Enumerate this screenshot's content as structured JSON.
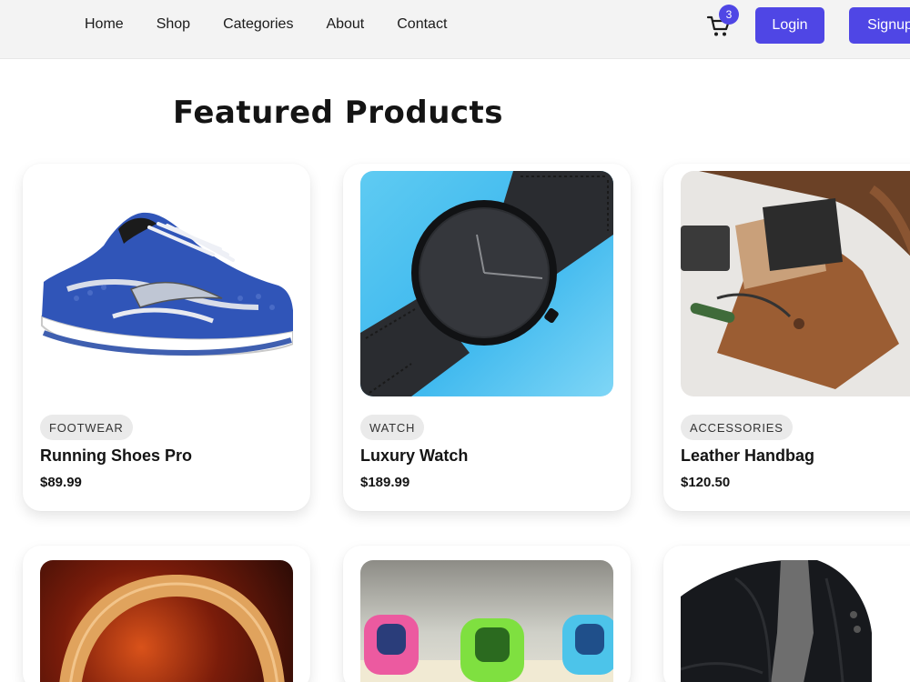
{
  "nav": {
    "links": [
      "Home",
      "Shop",
      "Categories",
      "About",
      "Contact"
    ],
    "cart_count": "3",
    "login_label": "Login",
    "signup_label": "Signup"
  },
  "section": {
    "title": "Featured Products"
  },
  "products": [
    {
      "category": "FOOTWEAR",
      "name": "Running Shoes Pro",
      "price": "$89.99"
    },
    {
      "category": "WATCH",
      "name": "Luxury Watch",
      "price": "$189.99"
    },
    {
      "category": "ACCESSORIES",
      "name": "Leather Handbag",
      "price": "$120.50"
    }
  ],
  "colors": {
    "accent": "#4f46e5",
    "navbar_bg": "#f3f3f3",
    "tag_bg": "#eaeaea"
  },
  "icons": {
    "cart": "cart-icon"
  }
}
